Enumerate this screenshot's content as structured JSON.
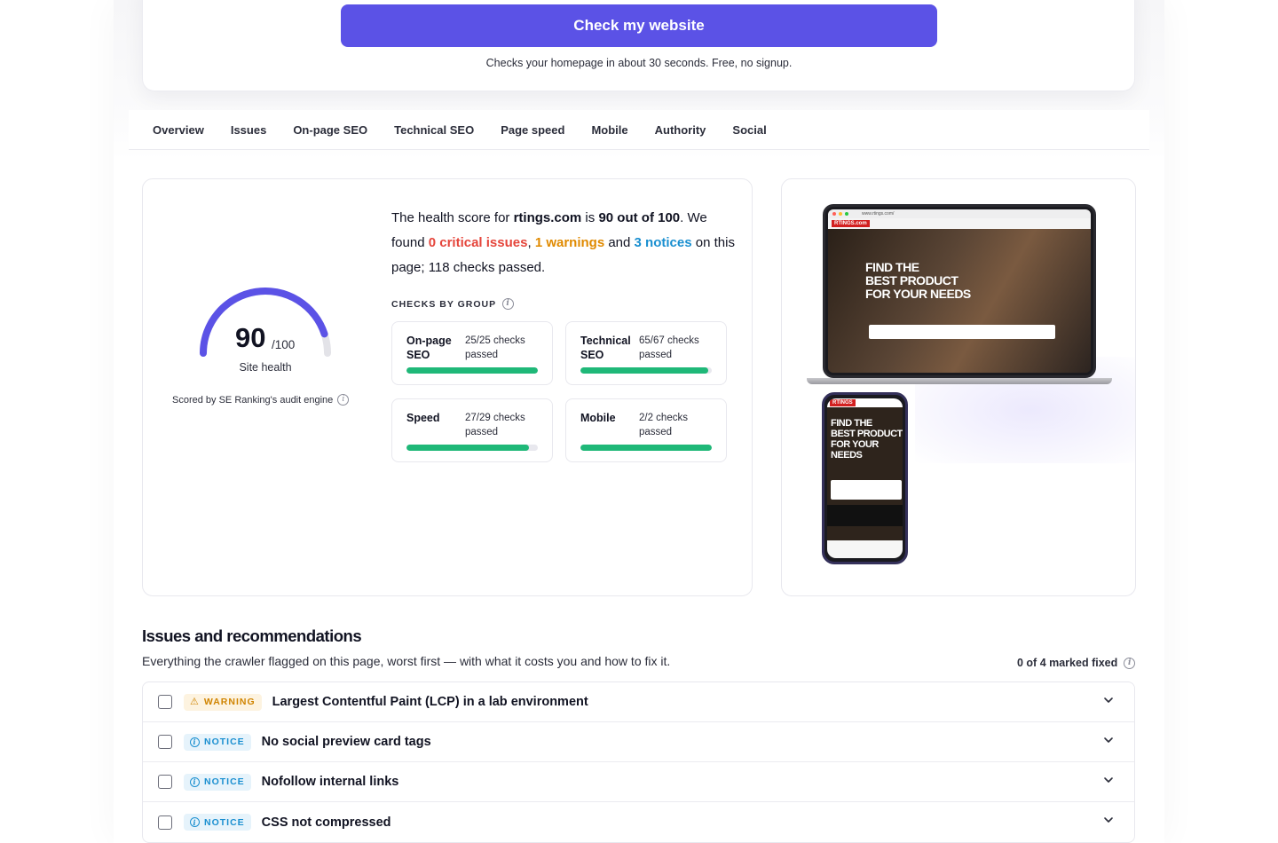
{
  "hero": {
    "cta_label": "Check my website",
    "cta_note": "Checks your homepage in about 30 seconds. Free, no signup."
  },
  "tabs": [
    {
      "label": "Overview"
    },
    {
      "label": "Issues"
    },
    {
      "label": "On-page SEO"
    },
    {
      "label": "Technical SEO"
    },
    {
      "label": "Page speed"
    },
    {
      "label": "Mobile"
    },
    {
      "label": "Authority"
    },
    {
      "label": "Social"
    }
  ],
  "score": {
    "value": "90",
    "max": "/100",
    "fraction": 0.9,
    "label": "Site health",
    "scored_by": "Scored by SE Ranking's audit engine",
    "accent": "#5b52e6"
  },
  "summary": {
    "p1": "The health score for ",
    "domain": "rtings.com",
    "p2": " is ",
    "score_text": "90 out of 100",
    "p3": ". We found ",
    "critical": "0 critical issues",
    "p4": ", ",
    "warnings": "1 warnings",
    "p5": " and ",
    "notices": "3 notices",
    "p6": " on this page; 118 checks passed."
  },
  "groups": {
    "title": "CHECKS BY GROUP",
    "items": [
      {
        "name": "On-page SEO",
        "stat": "25/25 checks passed",
        "fraction": 1.0
      },
      {
        "name": "Technical SEO",
        "stat": "65/67 checks passed",
        "fraction": 0.97
      },
      {
        "name": "Speed",
        "stat": "27/29 checks passed",
        "fraction": 0.93
      },
      {
        "name": "Mobile",
        "stat": "2/2 checks passed",
        "fraction": 1.0
      }
    ]
  },
  "preview": {
    "laptop_url": "www.rtings.com/",
    "laptop_logo": "RTINGS.com",
    "laptop_headline_1": "FIND THE",
    "laptop_headline_2": "BEST PRODUCT",
    "laptop_headline_3": "FOR YOUR NEEDS",
    "phone_logo": "RTINGS",
    "phone_headline_1": "FIND THE",
    "phone_headline_2": "BEST PRODUCT",
    "phone_headline_3": "FOR YOUR NEEDS"
  },
  "issues_section": {
    "title": "Issues and recommendations",
    "subtitle": "Everything the crawler flagged on this page, worst first — with what it costs you and how to fix it.",
    "fixed_count": "0 of 4 marked fixed",
    "items": [
      {
        "severity": "WARNING",
        "title": "Largest Contentful Paint (LCP) in a lab environment"
      },
      {
        "severity": "NOTICE",
        "title": "No social preview card tags"
      },
      {
        "severity": "NOTICE",
        "title": "Nofollow internal links"
      },
      {
        "severity": "NOTICE",
        "title": "CSS not compressed"
      }
    ]
  }
}
